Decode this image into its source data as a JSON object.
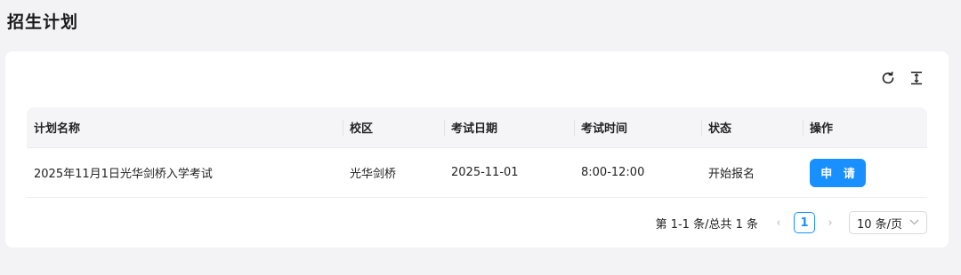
{
  "page": {
    "title": "招生计划"
  },
  "toolbar": {
    "reload_icon": "reload-icon",
    "density_icon": "column-height-icon"
  },
  "table": {
    "columns": [
      "计划名称",
      "校区",
      "考试日期",
      "考试时间",
      "状态",
      "操作"
    ],
    "rows": [
      {
        "name": "2025年11月1日光华剑桥入学考试",
        "campus": "光华剑桥",
        "date": "2025-11-01",
        "time": "8:00-12:00",
        "status": "开始报名",
        "action": "申 请"
      }
    ]
  },
  "pagination": {
    "total_text": "第 1-1 条/总共 1 条",
    "prev": "‹",
    "current_page": "1",
    "next": "›",
    "page_size": "10 条/页"
  },
  "colors": {
    "primary": "#1890ff",
    "background": "#f3f3f5"
  }
}
